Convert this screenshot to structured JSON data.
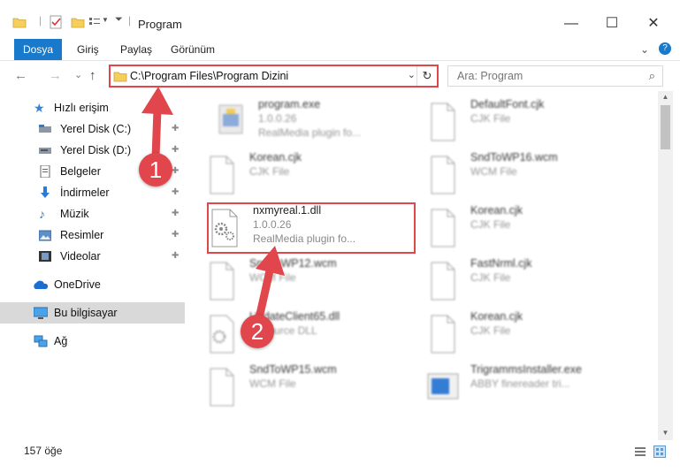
{
  "window": {
    "title": "Program",
    "minimize_glyph": "—",
    "maximize_glyph": "☐",
    "close_glyph": "✕"
  },
  "ribbon": {
    "tabs": [
      {
        "label": "Dosya",
        "active": true
      },
      {
        "label": "Giriş",
        "active": false
      },
      {
        "label": "Paylaş",
        "active": false
      },
      {
        "label": "Görünüm",
        "active": false
      }
    ],
    "expand_glyph": "⌄",
    "help_glyph": "?"
  },
  "address_bar": {
    "path": "C:\\Program Files\\Program Dizini",
    "dropdown_glyph": "⌄",
    "refresh_glyph": "↻"
  },
  "search": {
    "placeholder": "Ara: Program",
    "icon": "search-icon"
  },
  "nav": {
    "back_glyph": "←",
    "forward_glyph": "→",
    "recent_glyph": "⌄",
    "up_glyph": "↑"
  },
  "sidebar": {
    "quick_access": {
      "label": "Hızlı erişim",
      "icon": "star-icon"
    },
    "items": [
      {
        "label": "Yerel Disk (C:)",
        "icon": "drive-icon",
        "pinned": true
      },
      {
        "label": "Yerel Disk (D:)",
        "icon": "drive-icon",
        "pinned": true
      },
      {
        "label": "Belgeler",
        "icon": "documents-icon",
        "pinned": true
      },
      {
        "label": "İndirmeler",
        "icon": "download-icon",
        "pinned": true
      },
      {
        "label": "Müzik",
        "icon": "music-icon",
        "pinned": true
      },
      {
        "label": "Resimler",
        "icon": "pictures-icon",
        "pinned": true
      },
      {
        "label": "Videolar",
        "icon": "videos-icon",
        "pinned": true
      }
    ],
    "onedrive": {
      "label": "OneDrive",
      "icon": "cloud-icon"
    },
    "this_pc": {
      "label": "Bu bilgisayar",
      "icon": "computer-icon"
    },
    "network": {
      "label": "Ağ",
      "icon": "network-icon"
    },
    "pin_glyph": "📌"
  },
  "files": [
    {
      "name": "program.exe",
      "line2": "1.0.0.26",
      "line3": "RealMedia plugin fo...",
      "icon": "exe-icon",
      "blurred": true
    },
    {
      "name": "DefaultFont.cjk",
      "line2": "CJK File",
      "line3": "",
      "icon": "blank-file-icon",
      "blurred": true
    },
    {
      "name": "Korean.cjk",
      "line2": "CJK File",
      "line3": "",
      "icon": "blank-file-icon",
      "blurred": true
    },
    {
      "name": "SndToWP16.wcm",
      "line2": "WCM File",
      "line3": "",
      "icon": "blank-file-icon",
      "blurred": true
    },
    {
      "name": "nxmyreal.1.dll",
      "line2": "1.0.0.26",
      "line3": "RealMedia plugin fo...",
      "icon": "dll-icon",
      "blurred": false
    },
    {
      "name": "Korean.cjk",
      "line2": "CJK File",
      "line3": "",
      "icon": "blank-file-icon",
      "blurred": true
    },
    {
      "name": "SndToWP12.wcm",
      "line2": "WCM File",
      "line3": "",
      "icon": "blank-file-icon",
      "blurred": true
    },
    {
      "name": "FastNrml.cjk",
      "line2": "CJK File",
      "line3": "",
      "icon": "blank-file-icon",
      "blurred": true
    },
    {
      "name": "UpdateClient65.dll",
      "line2": "Resource DLL",
      "line3": "",
      "icon": "dll-icon",
      "blurred": true
    },
    {
      "name": "Korean.cjk",
      "line2": "CJK File",
      "line3": "",
      "icon": "blank-file-icon",
      "blurred": true
    },
    {
      "name": "SndToWP15.wcm",
      "line2": "WCM File",
      "line3": "",
      "icon": "blank-file-icon",
      "blurred": true
    },
    {
      "name": "TrigrammsInstaller.exe",
      "line2": "ABBY finereader tri...",
      "line3": "",
      "icon": "installer-icon",
      "blurred": true
    }
  ],
  "annotations": {
    "step1": "1",
    "step2": "2",
    "color": "#e0464c"
  },
  "status": {
    "item_count": "157 öğe"
  },
  "colors": {
    "accent": "#1979ca",
    "highlight": "#e0464c"
  }
}
